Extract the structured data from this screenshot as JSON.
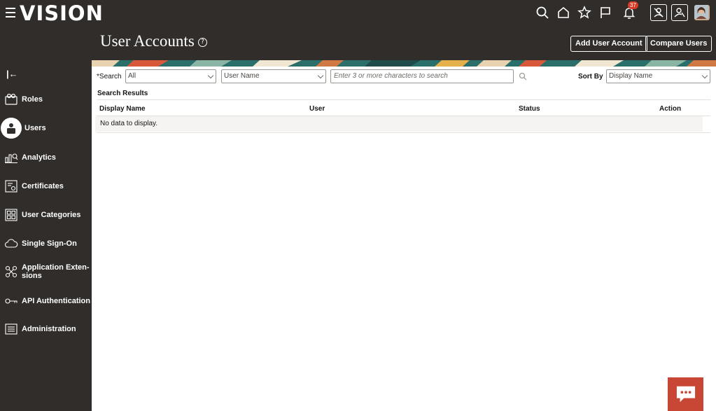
{
  "app": {
    "brand": "VISION",
    "notification_count": "37"
  },
  "page": {
    "title": "User Accounts",
    "help_glyph": "?",
    "add_button": "Add User Account",
    "compare_button": "Compare Users"
  },
  "sidebar": {
    "items": [
      {
        "label": "Roles",
        "icon": "roles-icon"
      },
      {
        "label": "Users",
        "icon": "users-icon",
        "active": true
      },
      {
        "label": "Analytics",
        "icon": "analytics-icon"
      },
      {
        "label": "Certificates",
        "icon": "certificate-icon"
      },
      {
        "label": "User Categories",
        "icon": "user-categories-icon"
      },
      {
        "label": "Single Sign-On",
        "icon": "cloud-icon"
      },
      {
        "label": "Application Exten-",
        "label2": "sions",
        "icon": "extensions-icon"
      },
      {
        "label": "API Authentication",
        "icon": "key-icon"
      },
      {
        "label": "Administration",
        "icon": "administration-icon"
      }
    ]
  },
  "search": {
    "required_mark": "*",
    "label": "Search",
    "scope_value": "All",
    "field_value": "User Name",
    "placeholder": "Enter 3 or more characters to search",
    "sort_label": "Sort By",
    "sort_value": "Display Name"
  },
  "results": {
    "label": "Search Results",
    "columns": [
      "Display Name",
      "User",
      "Status",
      "Action"
    ],
    "empty_message": "No data to display."
  },
  "colors": {
    "header_bg": "#312d2a",
    "accent": "#c74634",
    "badge": "#d63b25"
  }
}
